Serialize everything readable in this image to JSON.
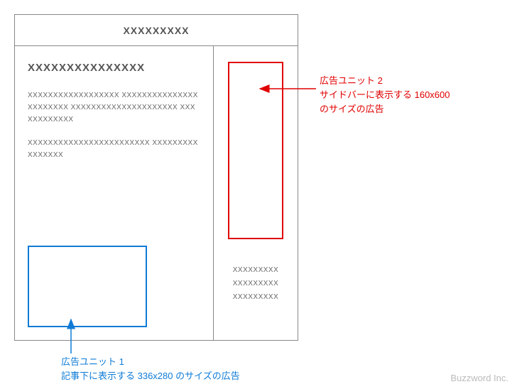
{
  "wireframe": {
    "header_title": "XXXXXXXXX",
    "main": {
      "article_title": "XXXXXXXXXXXXXXX",
      "para1": "XXXXXXXXXXXXXXXXXX XXXXXXXXXXXXXXXXXXXXXXX XXXXXXXXXXXXXXXXXXXXX XXXXXXXXXXXX",
      "para2": "XXXXXXXXXXXXXXXXXXXXXXXX XXXXXXXXXXXXXXXX"
    },
    "sidebar": {
      "items": [
        "XXXXXXXXX",
        "XXXXXXXXX",
        "XXXXXXXXX"
      ]
    }
  },
  "annotations": {
    "ad_unit_2": {
      "title": "広告ユニット 2",
      "desc1": "サイドバーに表示する 160x600",
      "desc2": "のサイズの広告"
    },
    "ad_unit_1": {
      "title": "広告ユニット 1",
      "desc": "記事下に表示する 336x280 のサイズの広告"
    }
  },
  "brand": "Buzzword Inc.",
  "colors": {
    "blue": "#0f7bd6",
    "red": "#e00000"
  }
}
